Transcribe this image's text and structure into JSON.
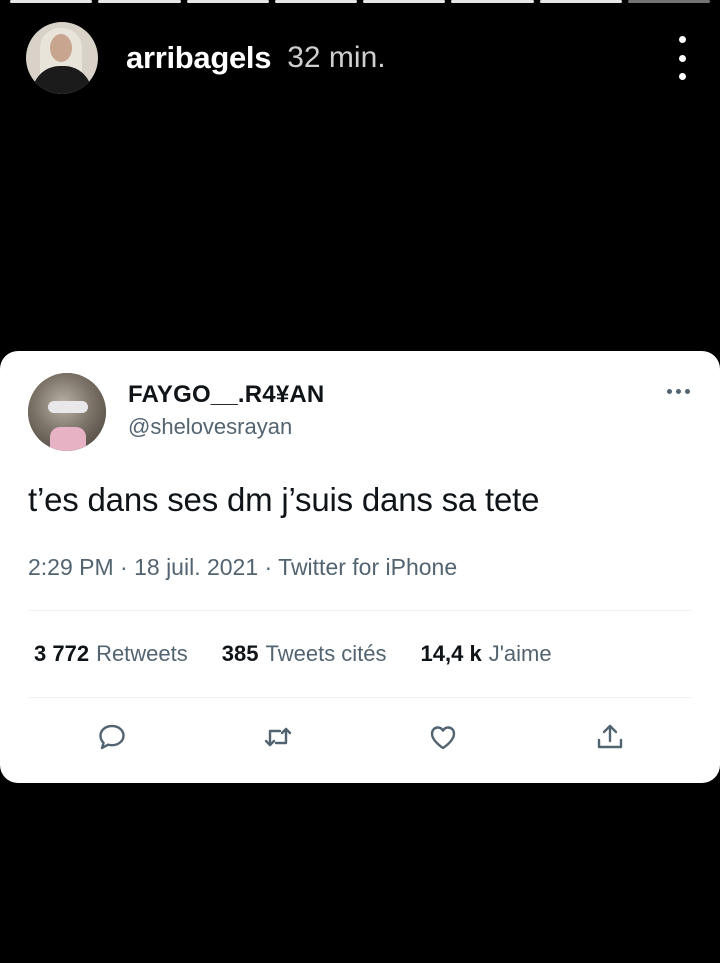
{
  "story": {
    "username": "arribagels",
    "time": "32 min.",
    "progress_segments": 8,
    "progress_active": 7
  },
  "tweet": {
    "display_name": "FAYGO__.R4¥AN",
    "handle": "@shelovesrayan",
    "text": "t’es dans ses dm j’suis dans sa tete",
    "meta": "2:29 PM · 18 juil. 2021 · Twitter for iPhone",
    "stats": [
      {
        "num": "3 772",
        "label": "Retweets"
      },
      {
        "num": "385",
        "label": "Tweets cités"
      },
      {
        "num": "14,4 k",
        "label": "J'aime"
      }
    ]
  },
  "icons": {
    "reply": "comment-icon",
    "retweet": "retweet-icon",
    "like": "heart-icon",
    "share": "share-icon",
    "more": "more-dots-icon"
  },
  "colors": {
    "story_bg": "#000000",
    "card_bg": "#ffffff",
    "text_primary": "#0f1419",
    "text_secondary": "#536471"
  }
}
